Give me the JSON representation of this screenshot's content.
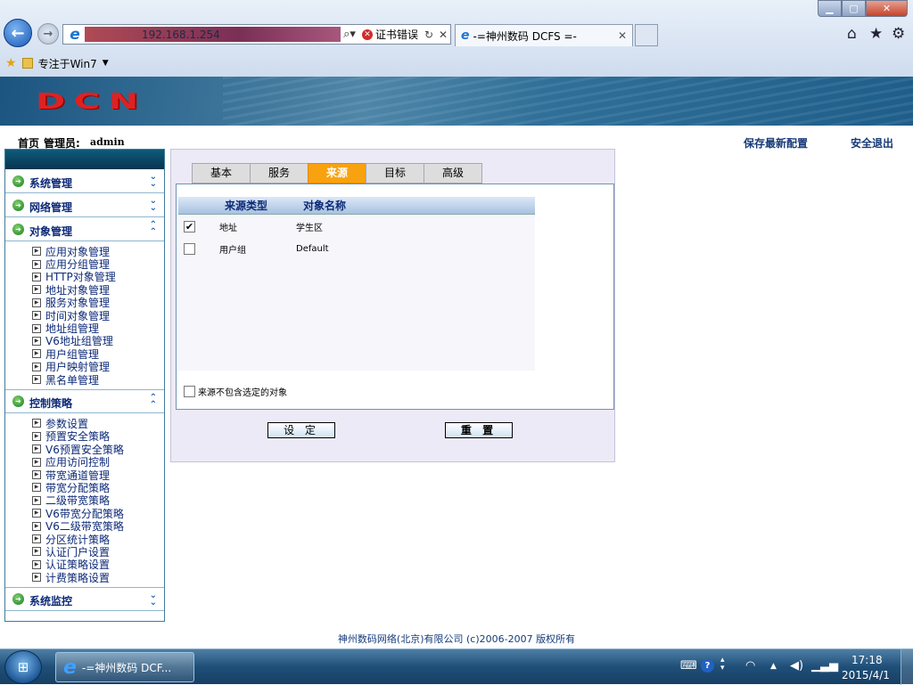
{
  "browser": {
    "url": "192.168.1.254",
    "cert_error": "证书错误",
    "tab_title": "-=神州数码 DCFS =-",
    "favorites_item": "专注于Win7"
  },
  "header": {
    "logo": "DCN",
    "home": "首页",
    "admin_label": "管理员:",
    "admin_name": "admin",
    "save_config": "保存最新配置",
    "logout": "安全退出"
  },
  "sidebar": {
    "sections": [
      {
        "label": "系统管理",
        "expanded": false
      },
      {
        "label": "网络管理",
        "expanded": false
      },
      {
        "label": "对象管理",
        "expanded": true,
        "items": [
          "应用对象管理",
          "应用分组管理",
          "HTTP对象管理",
          "地址对象管理",
          "服务对象管理",
          "时间对象管理",
          "地址组管理",
          "V6地址组管理",
          "用户组管理",
          "用户映射管理",
          "黑名单管理"
        ]
      },
      {
        "label": "控制策略",
        "expanded": true,
        "items": [
          "参数设置",
          "预置安全策略",
          "V6预置安全策略",
          "应用访问控制",
          "带宽通道管理",
          "带宽分配策略",
          "二级带宽策略",
          "V6带宽分配策略",
          "V6二级带宽策略",
          "分区统计策略",
          "认证门户设置",
          "认证策略设置",
          "计费策略设置"
        ]
      },
      {
        "label": "系统监控",
        "expanded": false
      }
    ]
  },
  "main": {
    "tabs": [
      "基本",
      "服务",
      "来源",
      "目标",
      "高级"
    ],
    "active_tab": "来源",
    "table": {
      "columns": [
        "来源类型",
        "对象名称"
      ],
      "rows": [
        {
          "checked": true,
          "type": "地址",
          "name": "学生区"
        },
        {
          "checked": false,
          "type": "用户组",
          "name": "Default"
        }
      ]
    },
    "exclude_label": "来源不包含选定的对象",
    "exclude_checked": false,
    "set_button": "设 定",
    "reset_button": "重 置"
  },
  "footer": {
    "copyright": "神州数码网络(北京)有限公司 (c)2006-2007 版权所有"
  },
  "taskbar": {
    "task_label": "-=神州数码 DCF...",
    "time": "17:18",
    "date": "2015/4/1"
  }
}
